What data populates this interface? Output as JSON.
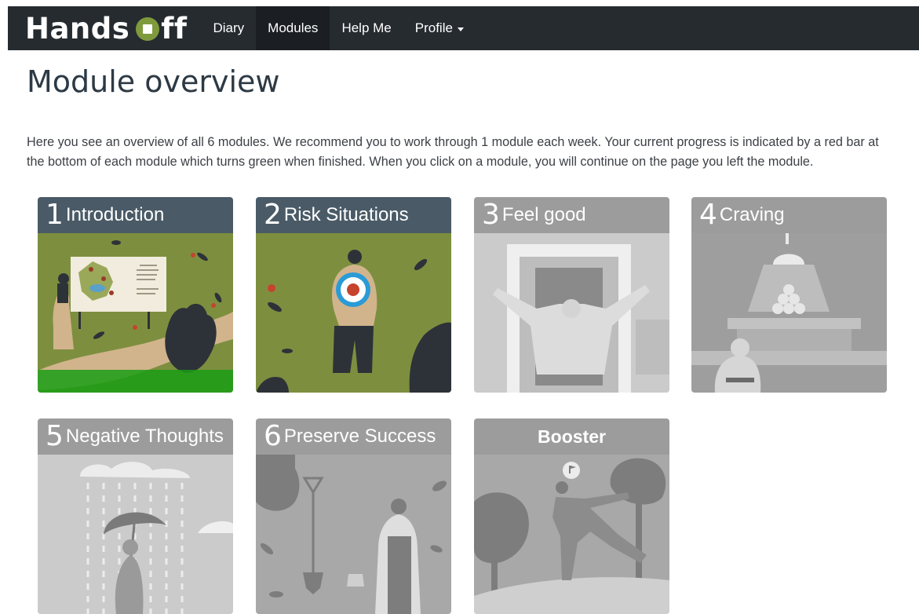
{
  "nav": {
    "brand_part1": "Hands",
    "brand_part2": "ff",
    "items": [
      {
        "label": "Diary"
      },
      {
        "label": "Modules"
      },
      {
        "label": "Help Me"
      },
      {
        "label": "Profile"
      }
    ]
  },
  "page": {
    "title": "Module overview",
    "intro": "Here you see an overview of all 6 modules. We recommend you to work through 1 module each week. Your current progress is indicated by a red bar at the bottom of each module which turns green when finished. When you click on a module, you will continue on the page you left the module."
  },
  "modules": [
    {
      "number": "1",
      "title": "Introduction",
      "state": "active",
      "progress": 1.0,
      "progress_color": "#1a9e14"
    },
    {
      "number": "2",
      "title": "Risk Situations",
      "state": "active"
    },
    {
      "number": "3",
      "title": "Feel good",
      "state": "locked"
    },
    {
      "number": "4",
      "title": "Craving",
      "state": "locked"
    },
    {
      "number": "5",
      "title": "Negative Thoughts",
      "state": "locked"
    },
    {
      "number": "6",
      "title": "Preserve Success",
      "state": "locked"
    },
    {
      "number": "",
      "title": "Booster",
      "state": "locked"
    }
  ],
  "colors": {
    "navbar": "#262b30",
    "module_header_active": "#4a5b67",
    "module_header_locked": "#9c9c9c",
    "art_green": "#7d8f3f",
    "finished_bar": "#1a9e14"
  }
}
